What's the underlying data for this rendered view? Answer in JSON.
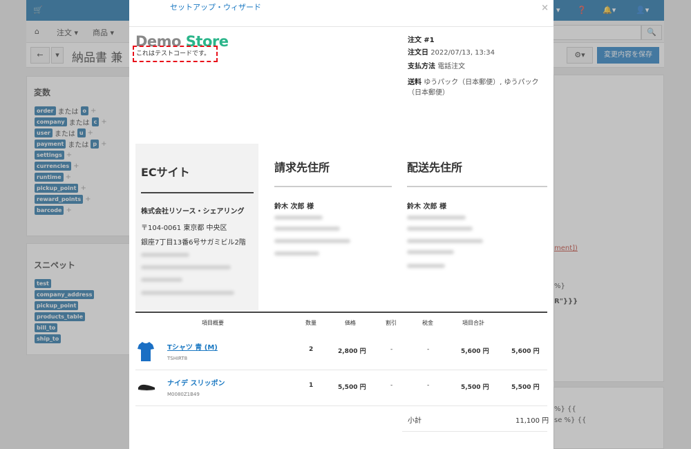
{
  "admin": {
    "nav": {
      "orders": "注文 ▾",
      "products": "商品 ▾"
    },
    "page_title": "納品書 兼",
    "save_label": "変更内容を保存",
    "variables_title": "変数",
    "variables": [
      {
        "tag": "order",
        "or": "または",
        "alias": "o"
      },
      {
        "tag": "company",
        "or": "または",
        "alias": "c"
      },
      {
        "tag": "user",
        "or": "または",
        "alias": "u"
      },
      {
        "tag": "payment",
        "or": "または",
        "alias": "p"
      },
      {
        "tag": "settings"
      },
      {
        "tag": "currencies"
      },
      {
        "tag": "runtime"
      },
      {
        "tag": "pickup_point"
      },
      {
        "tag": "reward_points"
      },
      {
        "tag": "barcode"
      }
    ],
    "snippets_title": "スニペット",
    "snippets": [
      "test",
      "company_address",
      "pickup_point",
      "products_table",
      "bill_to",
      "ship_to"
    ],
    "right_fragments": [
      "ment])",
      "%}",
      "R\"}}}",
      "%} {{",
      "se %} {{"
    ]
  },
  "modal": {
    "title": "セットアップ・ウィザード",
    "close": "×",
    "logo_demo": "Demo",
    "logo_store": "Store",
    "test_code": "これはテストコードです。",
    "order": {
      "number_label": "注文",
      "number_value": "#1",
      "date_label": "注文日",
      "date_value": "2022/07/13, 13:34",
      "payment_label": "支払方法",
      "payment_value": "電話注文",
      "shipping_label": "送料",
      "shipping_value": "ゆうパック（日本郵便）, ゆうパック（日本郵便）"
    },
    "ec_site": {
      "heading": "ECサイト",
      "company": "株式会社リソース・シェアリング",
      "zip_line": "〒104-0061 東京都 中央区",
      "street": "銀座7丁目13番6号サガミビル2階"
    },
    "bill_to": {
      "heading": "請求先住所",
      "name": "鈴木 次郎 様"
    },
    "ship_to": {
      "heading": "配送先住所",
      "name": "鈴木 次郎 様"
    },
    "table_headers": [
      "項目概要",
      "数量",
      "価格",
      "割引",
      "税金",
      "項目合計"
    ],
    "items": [
      {
        "name": "Tシャツ 青 (M)",
        "sku": "TSHIRT8",
        "qty": "2",
        "price": "2,800 円",
        "discount": "-",
        "tax": "-",
        "total": "5,600 円",
        "subtotal": "5,600 円"
      },
      {
        "name": "ナイデ スリッポン",
        "sku": "M0080Z1B49",
        "qty": "1",
        "price": "5,500 円",
        "discount": "-",
        "tax": "-",
        "total": "5,500 円",
        "subtotal": "5,500 円"
      }
    ],
    "subtotal_label": "小計",
    "subtotal_value": "11,100 円"
  },
  "colors": {
    "accent": "#1a78c2",
    "topbar": "#106aa6",
    "logo_green": "#2bb58a",
    "highlight": "#e8101a"
  }
}
